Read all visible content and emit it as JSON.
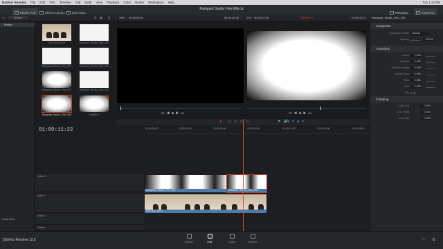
{
  "menubar": {
    "app": "DaVinci Resolve",
    "items": [
      "File",
      "Edit",
      "Trim",
      "Timeline",
      "Clip",
      "Mark",
      "View",
      "Playback",
      "Color",
      "Nodes",
      "Workspace",
      "Help"
    ],
    "right": "Tue 1:22 PM"
  },
  "title": "Rampant Studio Film Effects",
  "toolbar": {
    "media_pool": "Media Pool",
    "effects_library": "Effects Library",
    "edit_index": "Edit Index",
    "metadata": "Metadata",
    "inspector": "Inspector"
  },
  "left_panel": {
    "master": "Master",
    "smart_bins": "Smart Bins"
  },
  "media_pool": {
    "clips": [
      {
        "name": "IMG 0011.MOV"
      },
      {
        "name": "Rampant_Studio_Film_000"
      },
      {
        "name": "Rampant_Studio_Film_001"
      },
      {
        "name": "Rampant_Studio_Film_002"
      },
      {
        "name": "Rampant_Studio_Film_003"
      },
      {
        "name": "Rampant_Studio_Film_004"
      },
      {
        "name": "Rampant_Studio_Film_005"
      },
      {
        "name": "Timeline 1"
      }
    ]
  },
  "viewer": {
    "zoom": "39%",
    "source_tc": "00:00:00:00",
    "record_tc": "00:00:00:00",
    "dur": "00:00:14:18",
    "timeline_name": "Timeline 1",
    "program_tc": "01:00:11:22",
    "clip_name": "Rampant_Studio_Film_005"
  },
  "inspector": {
    "composite": {
      "header": "Composite",
      "mode_label": "Composite Mode",
      "mode_value": "Normal",
      "opacity_label": "Opacity",
      "opacity_value": "100.00"
    },
    "transform": {
      "header": "Transform",
      "rows": [
        {
          "label": "Zoom",
          "value": "1.000"
        },
        {
          "label": "Position",
          "value": "0.000"
        },
        {
          "label": "Rotation Angle",
          "value": "0.000"
        },
        {
          "label": "Anchor Point",
          "value": "0.000"
        },
        {
          "label": "Pitch",
          "value": "0.000"
        },
        {
          "label": "Yaw",
          "value": "0.000"
        },
        {
          "label": "Flip",
          "value": ""
        }
      ]
    },
    "cropping": {
      "header": "Cropping",
      "rows": [
        {
          "label": "Crop Left",
          "value": "0.000"
        },
        {
          "label": "Crop Right",
          "value": "0.000"
        },
        {
          "label": "Crop Top",
          "value": "0.000"
        }
      ]
    }
  },
  "timeline": {
    "timecode": "01:00:11:22",
    "ruler": [
      "01:00:00:00",
      "01:00:03:00",
      "01:00:06:00",
      "01:00:09:00",
      "01:00:12:00",
      "01:00:15:00",
      "01:00:18:00",
      "01:00:21:00"
    ],
    "tracks": {
      "video2": "Video 2",
      "video1": "Video 1",
      "audio1": "Audio 1",
      "master": "Master"
    },
    "clips": {
      "v2a": "Rampant_Studio_Film_000",
      "v2b": "Rampant_Studio_Film_005",
      "v1": "IMG 0011.MOV"
    }
  },
  "pages": [
    {
      "label": "Media"
    },
    {
      "label": "Edit"
    },
    {
      "label": "Color"
    },
    {
      "label": "Deliver"
    }
  ],
  "footer": {
    "app": "DaVinci Resolve 12.5"
  }
}
